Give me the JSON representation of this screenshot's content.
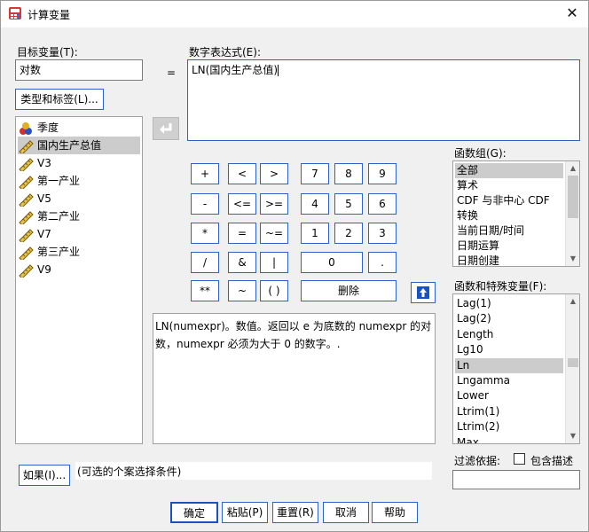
{
  "window": {
    "title": "计算变量",
    "close_glyph": "✕"
  },
  "target": {
    "label": "目标变量(T):",
    "value": "对数",
    "type_button": "类型和标签(L)..."
  },
  "equals": "=",
  "expression": {
    "label": "数字表达式(E):",
    "value": "LN(国内生产总值)"
  },
  "variables": [
    {
      "name": "季度",
      "kind": "nominal"
    },
    {
      "name": "国内生产总值",
      "kind": "scale",
      "selected": true
    },
    {
      "name": "V3",
      "kind": "scale"
    },
    {
      "name": "第一产业",
      "kind": "scale"
    },
    {
      "name": "V5",
      "kind": "scale"
    },
    {
      "name": "第二产业",
      "kind": "scale"
    },
    {
      "name": "V7",
      "kind": "scale"
    },
    {
      "name": "第三产业",
      "kind": "scale"
    },
    {
      "name": "V9",
      "kind": "scale"
    }
  ],
  "keypad": [
    [
      "+",
      "<",
      ">",
      "7",
      "8",
      "9"
    ],
    [
      "-",
      "<=",
      ">=",
      "4",
      "5",
      "6"
    ],
    [
      "*",
      "=",
      "~=",
      "1",
      "2",
      "3"
    ],
    [
      "/",
      "&",
      "|",
      "0",
      "."
    ],
    [
      "**",
      "~",
      "( )",
      "删除"
    ]
  ],
  "description": "LN(numexpr)。数值。返回以 e 为底数的 numexpr 的对数，numexpr 必须为大于 0 的数字。.",
  "function_group": {
    "label": "函数组(G):",
    "items": [
      "全部",
      "算术",
      "CDF 与非中心 CDF",
      "转换",
      "当前日期/时间",
      "日期运算",
      "日期创建"
    ],
    "selected_index": 0
  },
  "functions": {
    "label": "函数和特殊变量(F):",
    "items": [
      "Lag(1)",
      "Lag(2)",
      "Length",
      "Lg10",
      "Ln",
      "Lngamma",
      "Lower",
      "Ltrim(1)",
      "Ltrim(2)",
      "Max"
    ],
    "selected_index": 4
  },
  "filter": {
    "label": "过滤依据:",
    "checkbox_label": "包含描述",
    "value": ""
  },
  "if_button": {
    "label": "如果(I)...",
    "condition_text": "(可选的个案选择条件)"
  },
  "buttons": {
    "ok": "确定",
    "paste": "粘贴(P)",
    "reset": "重置(R)",
    "cancel": "取消",
    "help": "帮助"
  }
}
